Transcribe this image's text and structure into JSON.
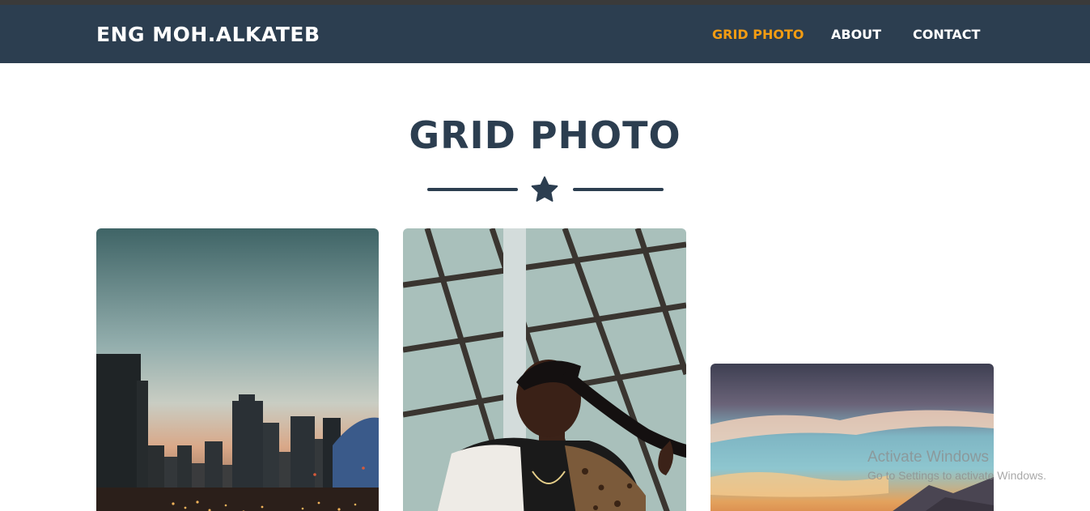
{
  "navbar": {
    "brand": "ENG MOH.ALKATEB",
    "links": [
      {
        "label": "GRID PHOTO",
        "active": true
      },
      {
        "label": "ABOUT",
        "active": false
      },
      {
        "label": "CONTACT",
        "active": false
      }
    ]
  },
  "section": {
    "title": "GRID PHOTO",
    "divider_icon": "star-icon"
  },
  "gallery": {
    "photos": [
      {
        "subject": "city-skyline-at-dusk"
      },
      {
        "subject": "woman-portrait-with-braid"
      },
      {
        "subject": "sunset-over-mountains"
      }
    ]
  },
  "watermark": {
    "title": "Activate Windows",
    "subtitle": "Go to Settings to activate Windows."
  },
  "colors": {
    "navbar_bg": "#2c3e50",
    "accent": "#f39c12",
    "heading": "#2c3e50"
  }
}
